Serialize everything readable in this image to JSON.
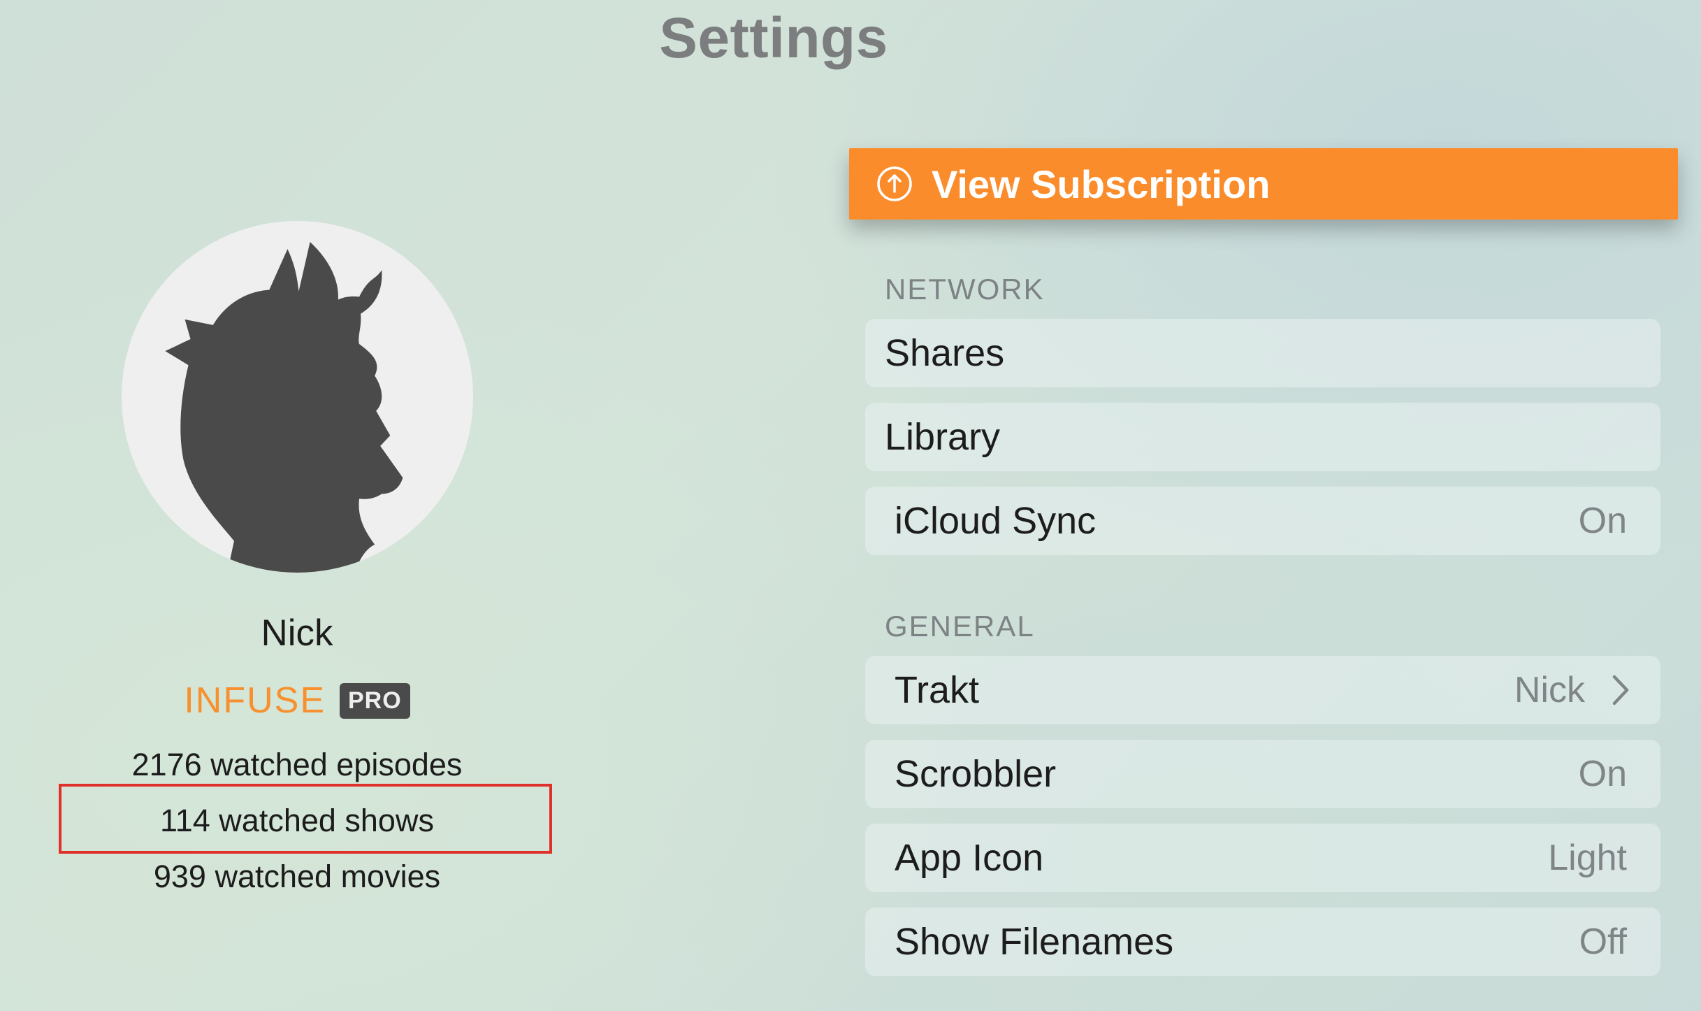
{
  "screen": {
    "title": "Settings"
  },
  "profile": {
    "name": "Nick",
    "brand": "INFUSE",
    "badge": "PRO",
    "stats": [
      "2176 watched episodes",
      "114 watched shows",
      "939 watched movies"
    ],
    "avatar_icon": "silhouette-avatar-icon"
  },
  "subscription": {
    "label": "View Subscription",
    "icon": "upgrade-arrow-icon",
    "color": "#fb8c2b"
  },
  "sections": [
    {
      "header": "NETWORK",
      "rows": [
        {
          "label": "Shares",
          "value": ""
        },
        {
          "label": "Library",
          "value": ""
        },
        {
          "label": "iCloud Sync",
          "value": "On"
        }
      ]
    },
    {
      "header": "GENERAL",
      "rows": [
        {
          "label": "Trakt",
          "value": "Nick",
          "icon": "chevron-right-icon"
        },
        {
          "label": "Scrobbler",
          "value": "On"
        },
        {
          "label": "App Icon",
          "value": "Light"
        },
        {
          "label": "Show Filenames",
          "value": "Off"
        }
      ]
    }
  ],
  "colors": {
    "accent": "#f7902e",
    "highlight_box": "#e0302a"
  }
}
